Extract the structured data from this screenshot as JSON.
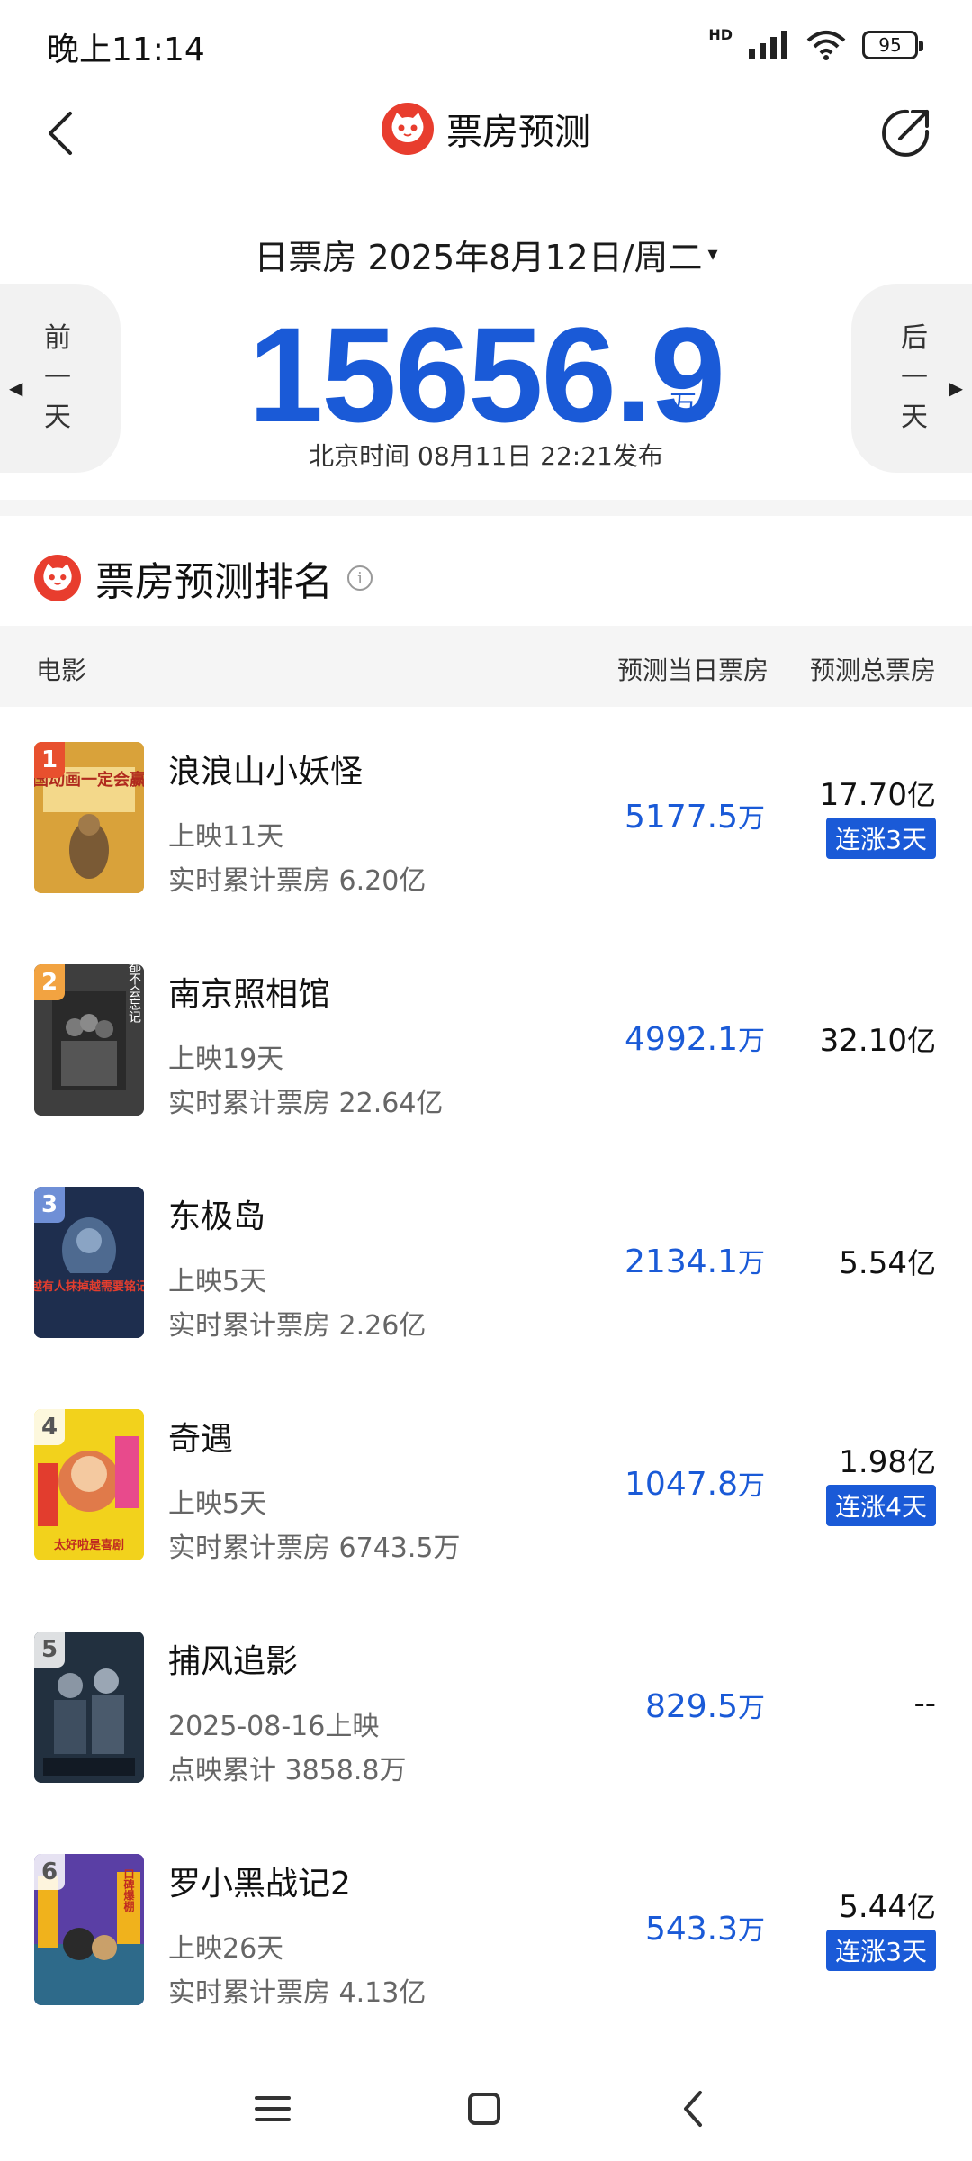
{
  "status": {
    "time": "晚上11:14",
    "network": "HD",
    "battery": "95"
  },
  "nav": {
    "title": "票房预测"
  },
  "date": {
    "label": "日票房 2025年8月12日/周二",
    "caret": "▾"
  },
  "day_nav": {
    "prev": [
      "前",
      "一",
      "天"
    ],
    "next": [
      "后",
      "一",
      "天"
    ]
  },
  "total": {
    "value": "15656.9",
    "unit": "万",
    "published": "北京时间  08月11日  22:21发布"
  },
  "ranking": {
    "title": "票房预测排名",
    "columns": {
      "movie": "电影",
      "day": "预测当日票房",
      "total": "预测总票房"
    },
    "rows": [
      {
        "rank": "1",
        "badge_color": "#e8502e",
        "title": "浪浪山小妖怪",
        "sub1": "上映11天",
        "sub2": "实时累计票房 6.20亿",
        "day": "5177.5",
        "day_unit": "万",
        "total": "17.70",
        "total_unit": "亿",
        "streak": "连涨3天"
      },
      {
        "rank": "2",
        "badge_color": "#f2a341",
        "title": "南京照相馆",
        "sub1": "上映19天",
        "sub2": "实时累计票房 22.64亿",
        "day": "4992.1",
        "day_unit": "万",
        "total": "32.10",
        "total_unit": "亿",
        "streak": ""
      },
      {
        "rank": "3",
        "badge_color": "#6f8fd6",
        "title": "东极岛",
        "sub1": "上映5天",
        "sub2": "实时累计票房 2.26亿",
        "day": "2134.1",
        "day_unit": "万",
        "total": "5.54",
        "total_unit": "亿",
        "streak": ""
      },
      {
        "rank": "4",
        "badge_color": "#cfcfcf",
        "title": "奇遇",
        "sub1": "上映5天",
        "sub2": "实时累计票房 6743.5万",
        "day": "1047.8",
        "day_unit": "万",
        "total": "1.98",
        "total_unit": "亿",
        "streak": "连涨4天"
      },
      {
        "rank": "5",
        "badge_color": "#cfcfcf",
        "title": "捕风追影",
        "sub1": "2025-08-16上映",
        "sub2": "点映累计 3858.8万",
        "day": "829.5",
        "day_unit": "万",
        "total": "--",
        "total_unit": "",
        "streak": ""
      },
      {
        "rank": "6",
        "badge_color": "#cfcfcf",
        "title": "罗小黑战记2",
        "sub1": "上映26天",
        "sub2": "实时累计票房 4.13亿",
        "day": "543.3",
        "day_unit": "万",
        "total": "5.44",
        "total_unit": "亿",
        "streak": "连涨3天"
      }
    ]
  },
  "posters": [
    {
      "bg": "#d9a23a",
      "text": "国动画一定会赢"
    },
    {
      "bg": "#4a4a4a",
      "text": "都不会忘记"
    },
    {
      "bg": "#23355a",
      "text": "越有人抹掉越需要铭记"
    },
    {
      "bg": "#f2d21c",
      "text": "太好啦是喜剧"
    },
    {
      "bg": "#2b3b4d",
      "text": ""
    },
    {
      "bg": "#6a4fb5",
      "text": "口碑爆棚"
    }
  ],
  "poster_texts": [
    "国动画一定会赢",
    "都不会忘记",
    "越有人抹掉越需要铭记",
    "太好啦是喜剧",
    "",
    "口碑爆棚"
  ]
}
